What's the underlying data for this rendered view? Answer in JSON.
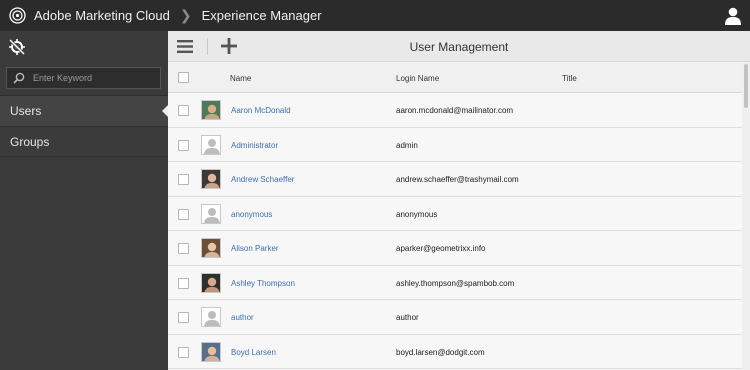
{
  "header": {
    "brand": "Adobe Marketing Cloud",
    "product": "Experience Manager"
  },
  "sidebar": {
    "search_placeholder": "Enter Keyword",
    "items": [
      {
        "label": "Users",
        "selected": true
      },
      {
        "label": "Groups",
        "selected": false
      }
    ]
  },
  "toolbar": {
    "title": "User Management"
  },
  "table": {
    "columns": [
      "Name",
      "Login Name",
      "Title"
    ],
    "rows": [
      {
        "name": "Aaron McDonald",
        "login": "aaron.mcdonald@mailinator.com",
        "title": "",
        "avatar": "photo"
      },
      {
        "name": "Administrator",
        "login": "admin",
        "title": "",
        "avatar": "placeholder"
      },
      {
        "name": "Andrew Schaeffer",
        "login": "andrew.schaeffer@trashymail.com",
        "title": "",
        "avatar": "photo"
      },
      {
        "name": "anonymous",
        "login": "anonymous",
        "title": "",
        "avatar": "placeholder"
      },
      {
        "name": "Alison Parker",
        "login": "aparker@geometrixx.info",
        "title": "",
        "avatar": "photo"
      },
      {
        "name": "Ashley Thompson",
        "login": "ashley.thompson@spambob.com",
        "title": "",
        "avatar": "photo"
      },
      {
        "name": "author",
        "login": "author",
        "title": "",
        "avatar": "placeholder"
      },
      {
        "name": "Boyd Larsen",
        "login": "boyd.larsen@dodgit.com",
        "title": "",
        "avatar": "photo"
      }
    ]
  },
  "colors": {
    "topbar": "#2b2b2b",
    "sidebar": "#3b3b3b",
    "link": "#3d6fb0"
  }
}
